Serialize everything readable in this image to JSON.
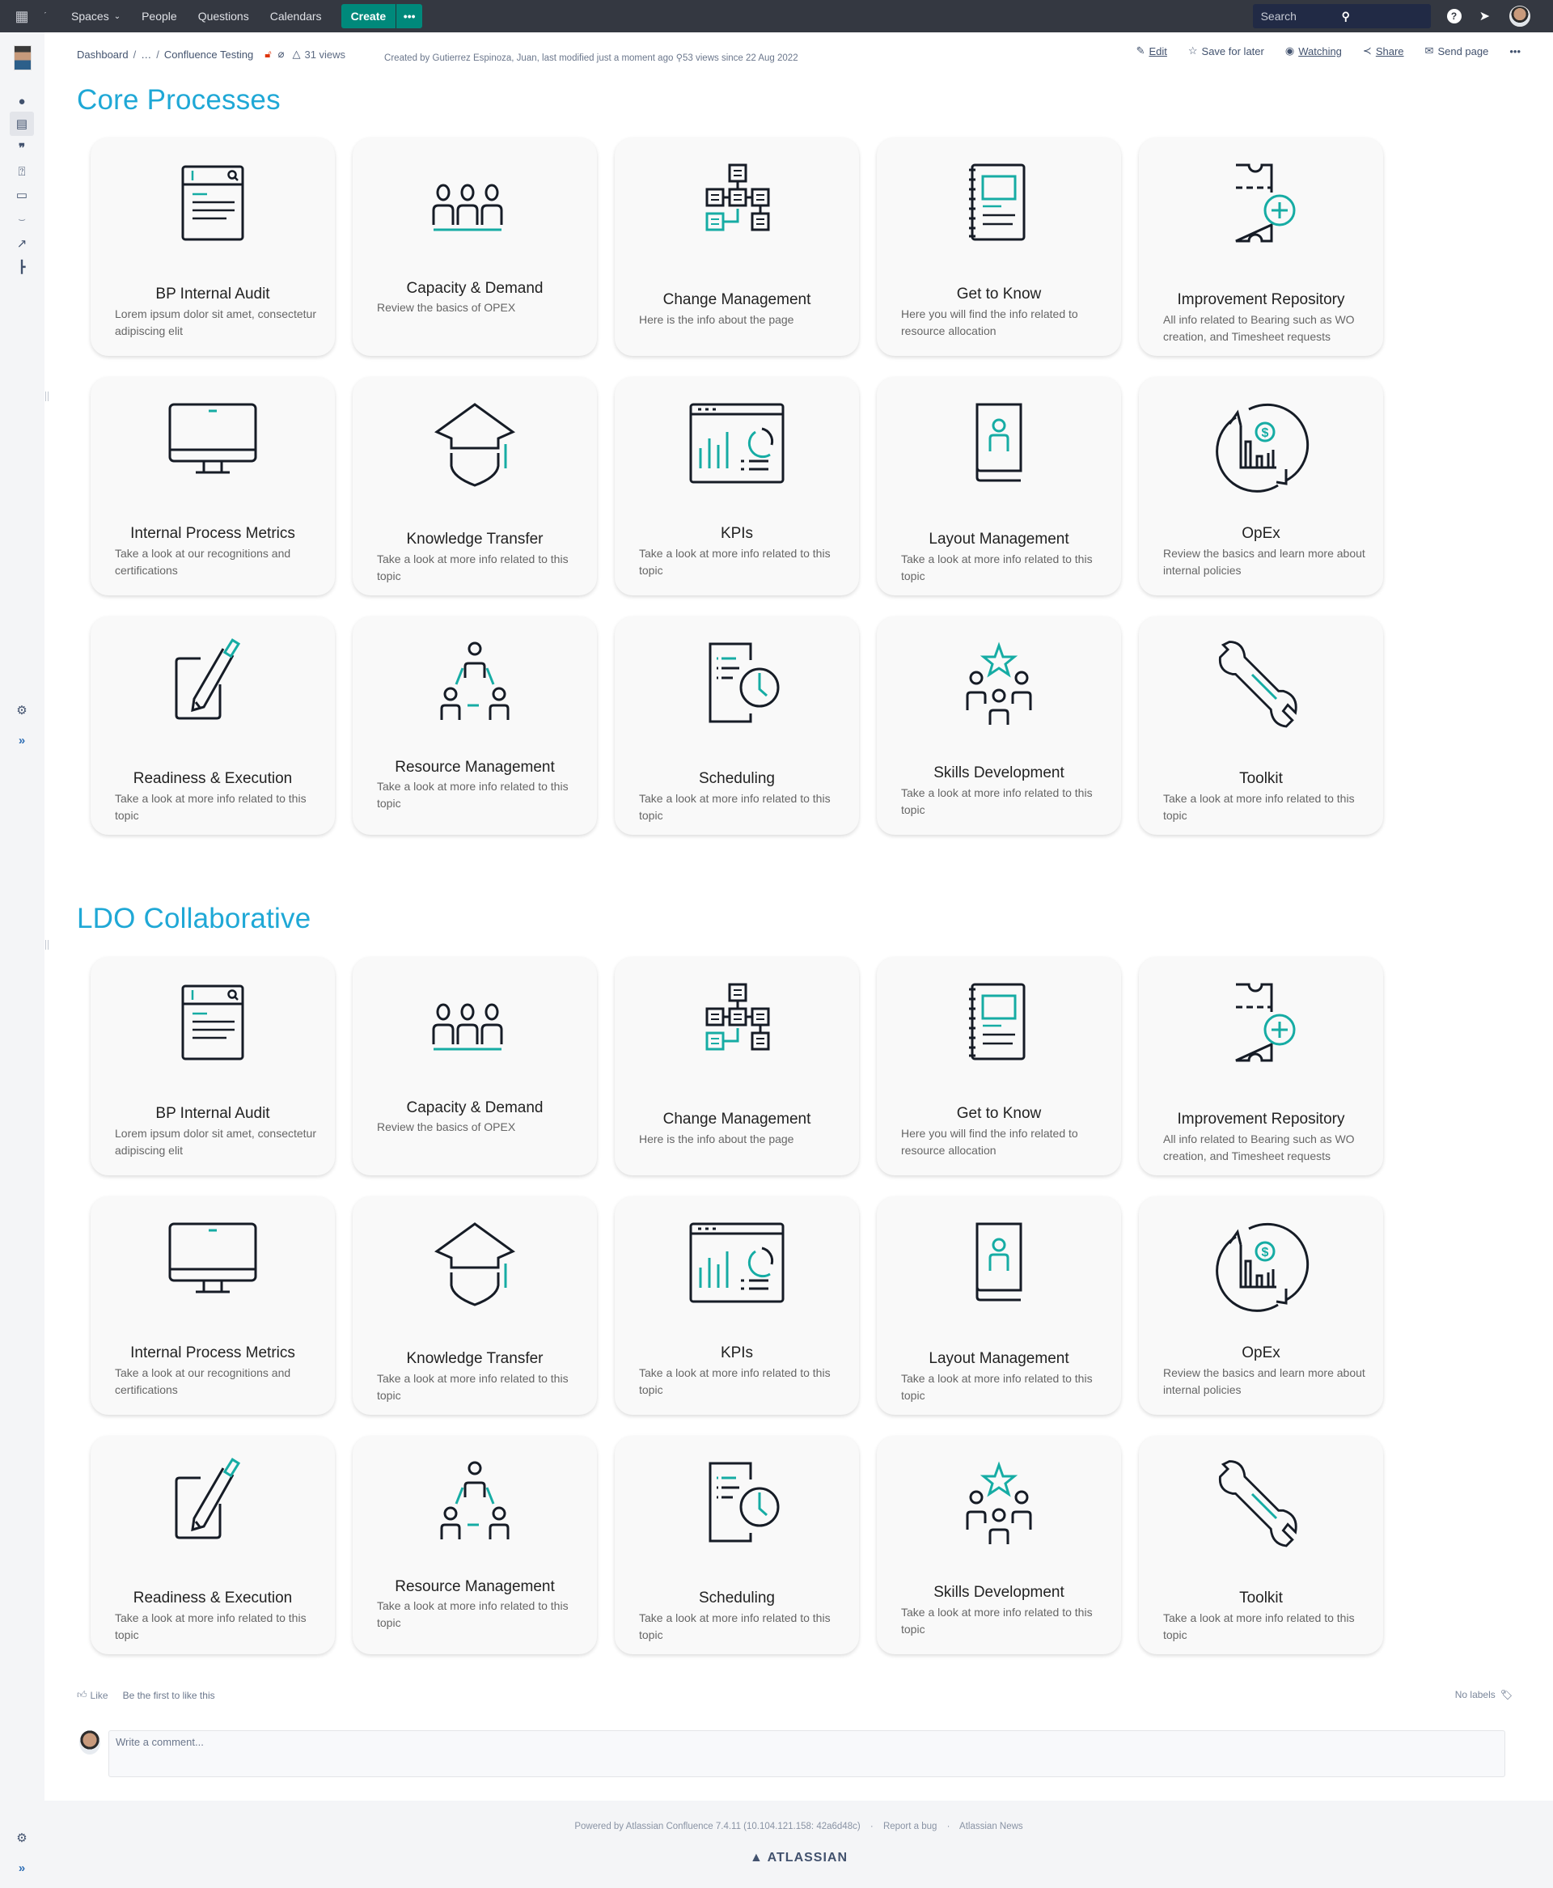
{
  "topnav": {
    "items": [
      {
        "label": "Spaces",
        "has_dropdown": true
      },
      {
        "label": "People"
      },
      {
        "label": "Questions"
      },
      {
        "label": "Calendars"
      }
    ],
    "create_label": "Create",
    "more_label": "•••",
    "search_placeholder": "Search",
    "help_icon": "?",
    "accent_color": "#00897b"
  },
  "sidebar": {
    "icons": [
      "people-icon",
      "pages-icon",
      "blog-icon",
      "questions-icon",
      "calendar-icon",
      "analytics-icon",
      "shortcut-icon",
      "page-tree-icon"
    ],
    "active": "pages-icon"
  },
  "header": {
    "breadcrumb": [
      "Dashboard",
      "…",
      "Confluence Testing"
    ],
    "views": "31 views",
    "meta": "Created by Gutierrez Espinoza, Juan, last modified just a moment ago",
    "meta_views": "53 views since 22 Aug 2022",
    "actions": [
      {
        "label": "Edit",
        "icon": "pencil-icon"
      },
      {
        "label": "Save for later",
        "icon": "star-icon"
      },
      {
        "label": "Watching",
        "icon": "eye-icon"
      },
      {
        "label": "Share",
        "icon": "share-icon"
      },
      {
        "label": "Send page",
        "icon": "mail-icon"
      },
      {
        "label": "•••",
        "icon": "more-icon"
      }
    ]
  },
  "sections": [
    {
      "title": "Core Processes",
      "cards": [
        {
          "title": "BP Internal Audit",
          "desc": "Lorem ipsum dolor sit amet, consectetur adipiscing elit",
          "icon": "audit"
        },
        {
          "title": "Capacity & Demand",
          "desc": "Review the basics of OPEX",
          "icon": "people-row"
        },
        {
          "title": "Change Management",
          "desc": "Here is the info about the page",
          "icon": "org-chart"
        },
        {
          "title": "Get to Know",
          "desc": "Here you will find the info related to resource allocation",
          "icon": "notebook"
        },
        {
          "title": "Improvement Repository",
          "desc": "All info related to Bearing such as WO creation, and Timesheet requests",
          "icon": "ticket-plus"
        },
        {
          "title": "Internal Process Metrics",
          "desc": "Take a look at our recognitions and certifications",
          "icon": "monitor"
        },
        {
          "title": "Knowledge Transfer",
          "desc": "Take a look at more info related to this topic",
          "icon": "graduate"
        },
        {
          "title": "KPIs",
          "desc": "Take a look at more info related to this topic",
          "icon": "dashboard"
        },
        {
          "title": "Layout Management",
          "desc": "Take a look at more info related to this topic",
          "icon": "profile-book"
        },
        {
          "title": "OpEx",
          "desc": "Review the basics and learn more about internal policies",
          "icon": "opex-cycle"
        },
        {
          "title": "Readiness & Execution",
          "desc": "Take a look at more info related to this topic",
          "icon": "pencil-pad"
        },
        {
          "title": "Resource Management",
          "desc": "Take a look at more info related to this topic",
          "icon": "team-triangle"
        },
        {
          "title": "Scheduling",
          "desc": "Take a look at more info related to this topic",
          "icon": "schedule-clock"
        },
        {
          "title": "Skills Development",
          "desc": "Take a look at more info related to this topic",
          "icon": "team-star"
        },
        {
          "title": "Toolkit",
          "desc": "Take a look at more info related to this topic",
          "icon": "wrench"
        }
      ]
    },
    {
      "title": "LDO Collaborative",
      "cards": [
        {
          "title": "BP Internal Audit",
          "desc": "Lorem ipsum dolor sit amet, consectetur adipiscing elit",
          "icon": "audit"
        },
        {
          "title": "Capacity & Demand",
          "desc": "Review the basics of OPEX",
          "icon": "people-row"
        },
        {
          "title": "Change Management",
          "desc": "Here is the info about the page",
          "icon": "org-chart"
        },
        {
          "title": "Get to Know",
          "desc": "Here you will find the info related to resource allocation",
          "icon": "notebook"
        },
        {
          "title": "Improvement Repository",
          "desc": "All info related to Bearing such as WO creation, and Timesheet requests",
          "icon": "ticket-plus"
        },
        {
          "title": "Internal Process Metrics",
          "desc": "Take a look at our recognitions and certifications",
          "icon": "monitor"
        },
        {
          "title": "Knowledge Transfer",
          "desc": "Take a look at more info related to this topic",
          "icon": "graduate"
        },
        {
          "title": "KPIs",
          "desc": "Take a look at more info related to this topic",
          "icon": "dashboard"
        },
        {
          "title": "Layout Management",
          "desc": "Take a look at more info related to this topic",
          "icon": "profile-book"
        },
        {
          "title": "OpEx",
          "desc": "Review the basics and learn more about internal policies",
          "icon": "opex-cycle"
        },
        {
          "title": "Readiness & Execution",
          "desc": "Take a look at more info related to this topic",
          "icon": "pencil-pad"
        },
        {
          "title": "Resource Management",
          "desc": "Take a look at more info related to this topic",
          "icon": "team-triangle"
        },
        {
          "title": "Scheduling",
          "desc": "Take a look at more info related to this topic",
          "icon": "schedule-clock"
        },
        {
          "title": "Skills Development",
          "desc": "Take a look at more info related to this topic",
          "icon": "team-star"
        },
        {
          "title": "Toolkit",
          "desc": "Take a look at more info related to this topic",
          "icon": "wrench"
        }
      ]
    }
  ],
  "colors": {
    "heading": "#1fa8d6",
    "icon_dark": "#161c26",
    "icon_accent": "#16aca4"
  },
  "feedback": {
    "like_label": "Like",
    "like_hint": "Be the first to like this",
    "labels_text": "No labels",
    "comment_placeholder": "Write a comment..."
  },
  "footer": {
    "powered_by": "Powered by Atlassian Confluence 7.4.11 (10.104.121.158: 42a6d48c)",
    "report_bug": "Report a bug",
    "news": "Atlassian News",
    "brand": "ATLASSIAN"
  }
}
